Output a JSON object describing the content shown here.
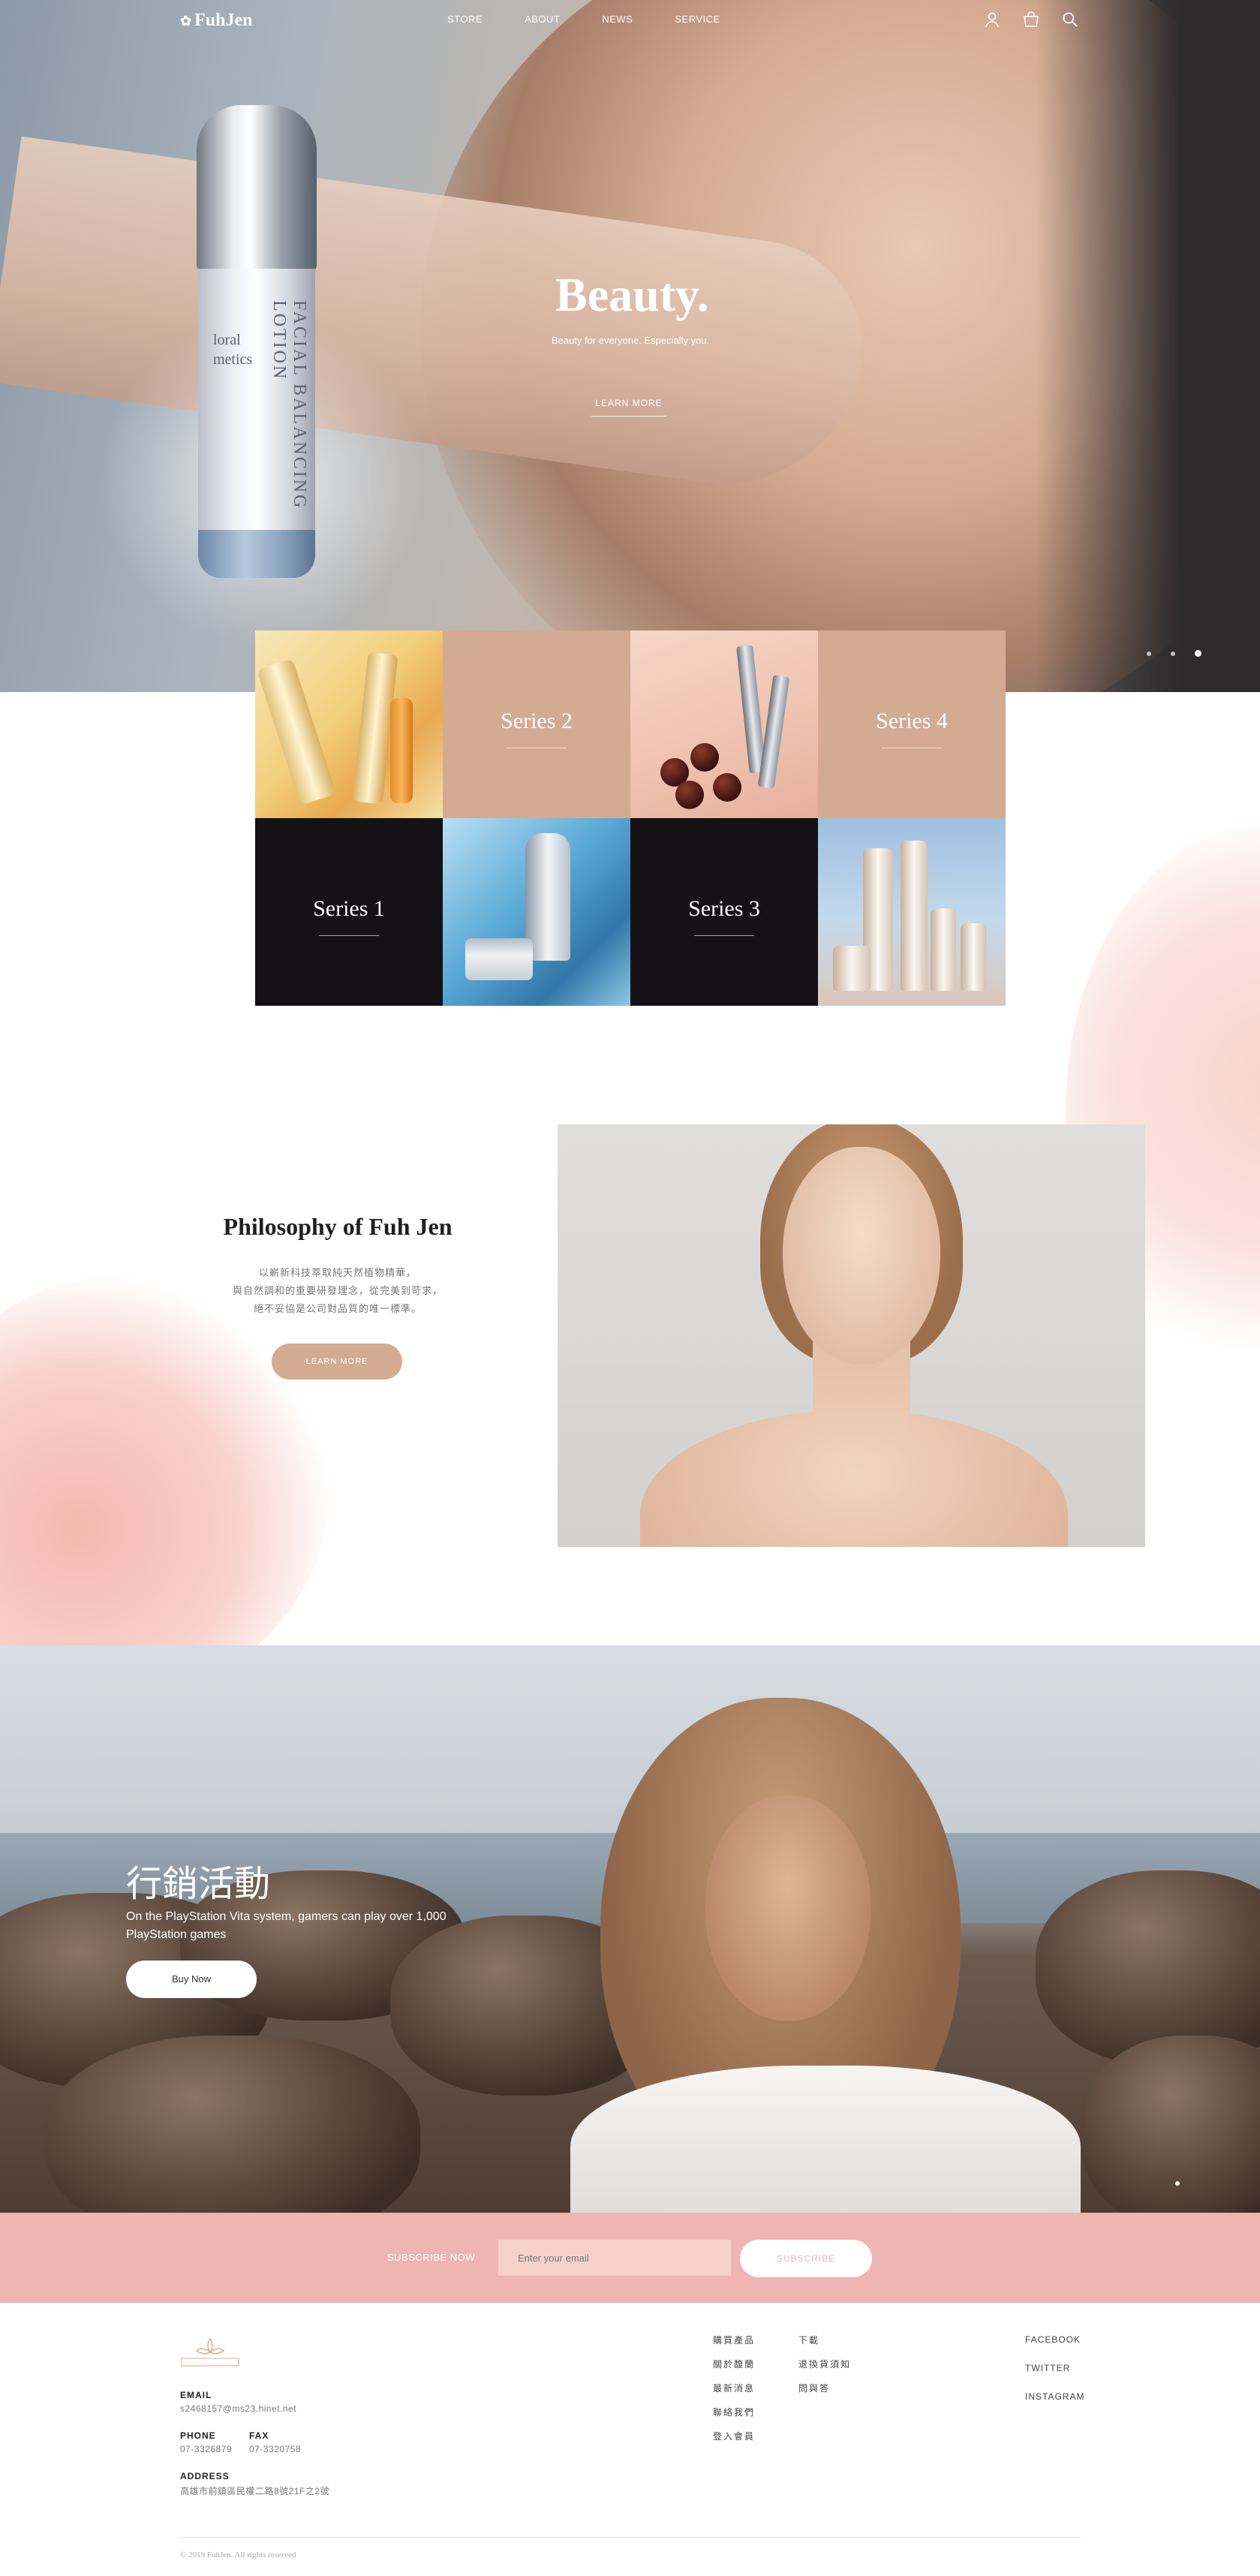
{
  "nav": {
    "logo": "FuhJen",
    "links": [
      "STORE",
      "ABOUT",
      "NEWS",
      "SERVICE"
    ],
    "icons": [
      "user-icon",
      "bag-icon",
      "search-icon"
    ]
  },
  "hero": {
    "title": "Beauty.",
    "subtitle": "Beauty for everyone. Especially you.",
    "cta": "LEARN MORE",
    "bottle_side_text": "FACIAL BALANCING LOTION",
    "bottle_brand_text": "loral\nmetics",
    "slides": 3,
    "active_slide": 3
  },
  "series": {
    "items": [
      "Series 1",
      "Series 2",
      "Series 3",
      "Series 4"
    ]
  },
  "philosophy": {
    "title": "Philosophy of Fuh Jen",
    "lines": [
      "以嶄新科技萃取純天然植物精華，",
      "與自然調和的重要研發理念，從完美到苛求，",
      "絕不妥協是公司對品質的唯一標準。"
    ],
    "button": "LEARN MORE"
  },
  "promo": {
    "title": "行銷活動",
    "text": "On the PlayStation Vita system, gamers can play over 1,000 PlayStation games",
    "button": "Buy Now"
  },
  "subscribe": {
    "label": "SUBSCRIBE NOW",
    "placeholder": "Enter your email",
    "button": "SUBSCRIBE"
  },
  "footer": {
    "email_label": "EMAIL",
    "email": "s2468157@ms23.hinet.net",
    "phone_label": "PHONE",
    "phone": "07-3326879",
    "fax_label": "FAX",
    "fax": "07-3320758",
    "address_label": "ADDRESS",
    "address": "高雄市前鎮區民權二路8號21F之2號",
    "links_col1": [
      "購買產品",
      "關於馥蘭",
      "最新消息",
      "聯絡我們",
      "登入會員"
    ],
    "links_col2": [
      "下載",
      "退換貨須知",
      "問與答"
    ],
    "social": [
      "FACEBOOK",
      "TWITTER",
      "INSTAGRAM"
    ],
    "copyright": "© 2019 FuhJen. All rights reserved"
  }
}
